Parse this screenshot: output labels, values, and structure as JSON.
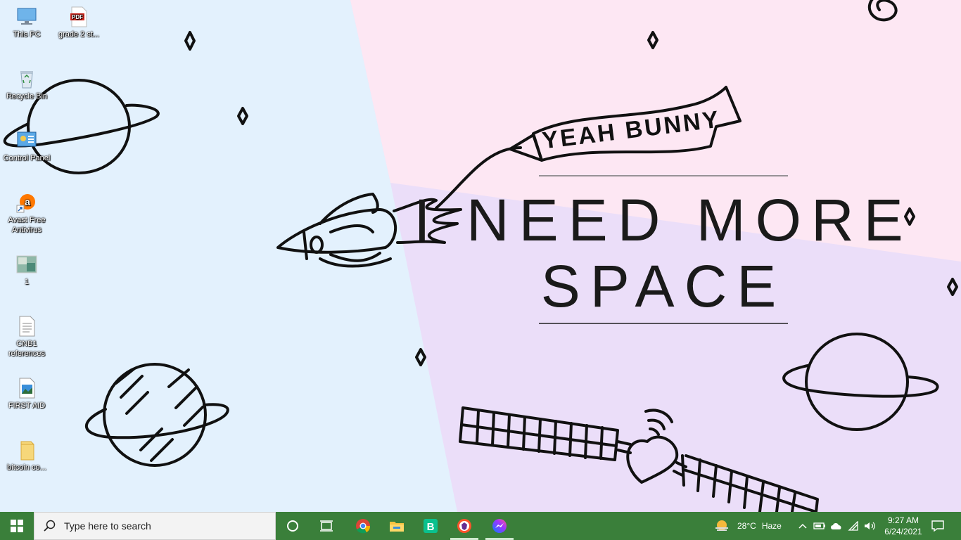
{
  "wallpaper": {
    "banner_text": "YEAH BUNNY",
    "headline_line1": "I NEED MORE",
    "headline_line2": "SPACE",
    "colors": {
      "left": "#e3f1fd",
      "right_top": "#fde7f3",
      "right_bottom": "#ebdef9",
      "ink": "#111111"
    }
  },
  "desktop": {
    "icons": [
      {
        "label": "This PC",
        "icon": "computer-icon"
      },
      {
        "label": "grade 2 st...",
        "icon": "pdf-icon"
      },
      {
        "label": "Recycle Bin",
        "icon": "recycle-bin-icon"
      },
      {
        "label": "Control Panel",
        "icon": "control-panel-icon"
      },
      {
        "label": "Avast Free Antivirus",
        "icon": "avast-icon"
      },
      {
        "label": "1",
        "icon": "image-thumbnail-icon"
      },
      {
        "label": "CNB1 references",
        "icon": "text-document-icon"
      },
      {
        "label": "FIRST AID",
        "icon": "image-file-icon"
      },
      {
        "label": "bitcoin co...",
        "icon": "folder-icon"
      }
    ]
  },
  "taskbar": {
    "background": "#3a7f3a",
    "search_placeholder": "Type here to search",
    "pinned": [
      "chrome-icon",
      "file-explorer-icon",
      "bitcoin-wallet-icon",
      "brave-icon",
      "messenger-icon"
    ],
    "weather": {
      "temp": "28°C",
      "condition": "Haze"
    },
    "clock": {
      "time": "9:27 AM",
      "date": "6/24/2021"
    }
  }
}
